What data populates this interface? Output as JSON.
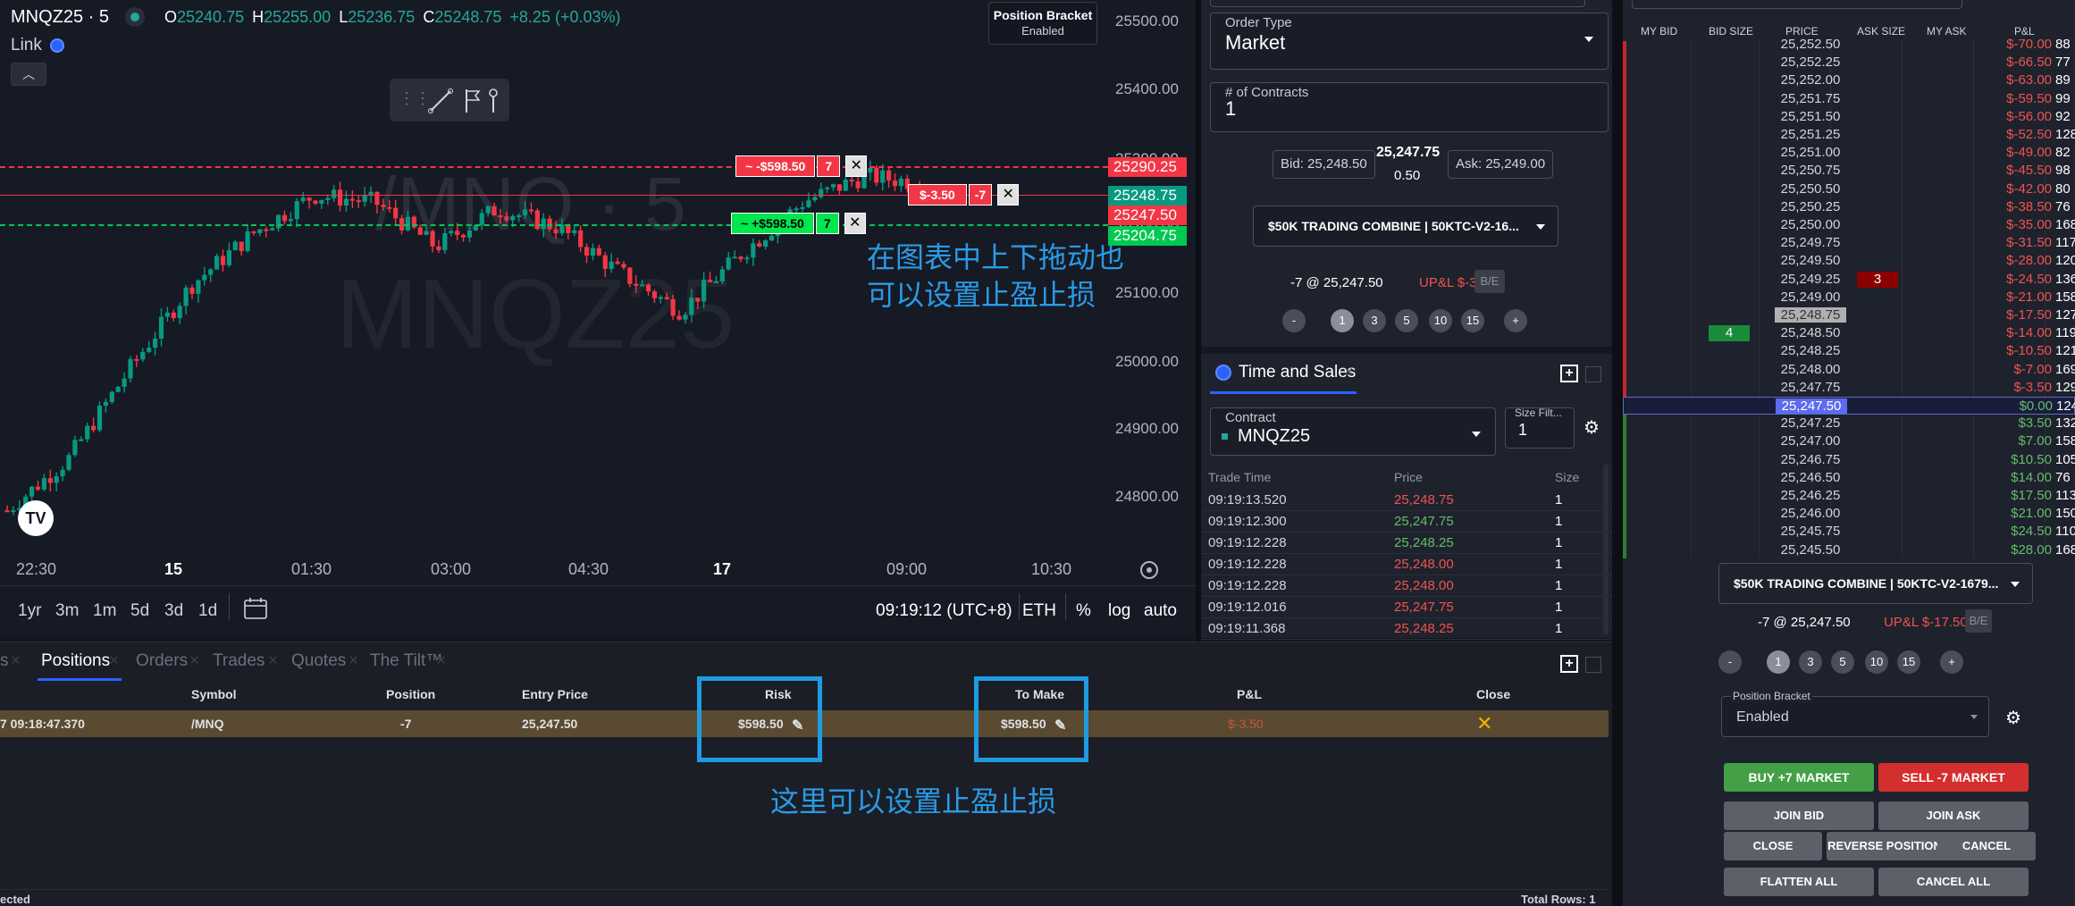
{
  "chart": {
    "symbol": "MNQZ25 · 5",
    "ohlc": {
      "o_label": "O",
      "o": "25240.75",
      "h_label": "H",
      "h": "25255.00",
      "l_label": "L",
      "l": "25236.75",
      "c_label": "C",
      "c": "25248.75",
      "change": "+8.25 (+0.03%)"
    },
    "link_label": "Link",
    "watermark_top": "/MNQ · 5",
    "watermark_bottom": "MNQZ25",
    "position_bracket_title": "Position Bracket",
    "position_bracket_value": "Enabled",
    "price_axis": [
      "25500.00",
      "25400.00",
      "25300.00",
      "25200.00",
      "25100.00",
      "25000.00",
      "24900.00",
      "24800.00"
    ],
    "price_tags": [
      {
        "label": "25290.25",
        "color": "#f23645"
      },
      {
        "label": "25248.75",
        "color": "#089981"
      },
      {
        "label": "25247.50",
        "color": "#f23645"
      },
      {
        "label": "25204.75",
        "color": "#00c853"
      }
    ],
    "order_tags": {
      "stop_text": "~ -$598.50",
      "stop_qty": "7",
      "target_text": "~ +$598.50",
      "target_qty": "7",
      "pos_text": "$-3.50",
      "pos_qty": "-7"
    },
    "time_axis": [
      "22:30",
      "15",
      "01:30",
      "03:00",
      "04:30",
      "17",
      "09:00",
      "10:30"
    ],
    "annotation": "在图表中上下拖动也\n可以设置止盈止损",
    "timeframes": [
      "1yr",
      "3m",
      "1m",
      "5d",
      "3d",
      "1d"
    ],
    "clock": "09:19:12 (UTC+8)",
    "session": "ETH",
    "scale_opts": [
      "%",
      "log",
      "auto"
    ]
  },
  "chart_data": {
    "type": "candlestick",
    "x": [
      "22:30",
      "15",
      "01:30",
      "03:00",
      "04:30",
      "17",
      "09:00"
    ],
    "close_path": [
      24740,
      24820,
      24960,
      25090,
      25170,
      25230,
      25220,
      25150,
      25210,
      25180,
      25110,
      25050,
      25140,
      25220,
      25260,
      25248.75
    ],
    "ylim": [
      24700,
      25520
    ]
  },
  "order_entry": {
    "order_type_label": "Order Type",
    "order_type_value": "Market",
    "contracts_label": "# of Contracts",
    "contracts_value": "1",
    "bid": "Bid: 25,248.50",
    "last": "25,247.75",
    "spread": "0.50",
    "ask": "Ask: 25,249.00",
    "account": "$50K TRADING COMBINE | 50KTC-V2-16...",
    "position": "-7 @ 25,247.50",
    "upl": "UP&L $-3.50",
    "be": "B/E",
    "qty_buttons": [
      "-",
      "1",
      "3",
      "5",
      "10",
      "15",
      "+"
    ]
  },
  "tns": {
    "title": "Time and Sales",
    "contract_label": "Contract",
    "contract_value": "MNQZ25",
    "size_filter_label": "Size Filt...",
    "size_filter_value": "1",
    "headers": [
      "Trade Time",
      "Price",
      "Size"
    ],
    "rows": [
      {
        "time": "09:19:13.520",
        "price": "25,248.75",
        "size": "1",
        "color": "#ef5350"
      },
      {
        "time": "09:19:12.300",
        "price": "25,247.75",
        "size": "1",
        "color": "#66bb6a"
      },
      {
        "time": "09:19:12.228",
        "price": "25,248.25",
        "size": "1",
        "color": "#66bb6a"
      },
      {
        "time": "09:19:12.228",
        "price": "25,248.00",
        "size": "1",
        "color": "#ef5350"
      },
      {
        "time": "09:19:12.228",
        "price": "25,248.00",
        "size": "1",
        "color": "#ef5350"
      },
      {
        "time": "09:19:12.016",
        "price": "25,247.75",
        "size": "1",
        "color": "#ef5350"
      },
      {
        "time": "09:19:11.368",
        "price": "25,248.25",
        "size": "1",
        "color": "#ef5350"
      }
    ]
  },
  "dom": {
    "headers": [
      "MY BID",
      "BID SIZE",
      "PRICE",
      "ASK SIZE",
      "MY ASK",
      "P&L"
    ],
    "rows": [
      {
        "price": "25,252.50",
        "ask": "",
        "bid": "",
        "pnl": "$-70.00",
        "extra": "88",
        "pc": "#ef5350"
      },
      {
        "price": "25,252.25",
        "ask": "",
        "bid": "",
        "pnl": "$-66.50",
        "extra": "77",
        "pc": "#ef5350"
      },
      {
        "price": "25,252.00",
        "ask": "",
        "bid": "",
        "pnl": "$-63.00",
        "extra": "89",
        "pc": "#ef5350"
      },
      {
        "price": "25,251.75",
        "ask": "",
        "bid": "",
        "pnl": "$-59.50",
        "extra": "99",
        "pc": "#ef5350"
      },
      {
        "price": "25,251.50",
        "ask": "",
        "bid": "",
        "pnl": "$-56.00",
        "extra": "92",
        "pc": "#ef5350"
      },
      {
        "price": "25,251.25",
        "ask": "",
        "bid": "",
        "pnl": "$-52.50",
        "extra": "128",
        "pc": "#ef5350"
      },
      {
        "price": "25,251.00",
        "ask": "",
        "bid": "",
        "pnl": "$-49.00",
        "extra": "82",
        "pc": "#ef5350"
      },
      {
        "price": "25,250.75",
        "ask": "",
        "bid": "",
        "pnl": "$-45.50",
        "extra": "98",
        "pc": "#ef5350"
      },
      {
        "price": "25,250.50",
        "ask": "",
        "bid": "",
        "pnl": "$-42.00",
        "extra": "80",
        "pc": "#ef5350"
      },
      {
        "price": "25,250.25",
        "ask": "",
        "bid": "",
        "pnl": "$-38.50",
        "extra": "76",
        "pc": "#ef5350"
      },
      {
        "price": "25,250.00",
        "ask": "",
        "bid": "",
        "pnl": "$-35.00",
        "extra": "168",
        "pc": "#ef5350"
      },
      {
        "price": "25,249.75",
        "ask": "",
        "bid": "",
        "pnl": "$-31.50",
        "extra": "117",
        "pc": "#ef5350"
      },
      {
        "price": "25,249.50",
        "ask": "",
        "bid": "",
        "pnl": "$-28.00",
        "extra": "120",
        "pc": "#ef5350"
      },
      {
        "price": "25,249.25",
        "ask": "3",
        "bid": "",
        "pnl": "$-24.50",
        "extra": "136",
        "pc": "#ef5350"
      },
      {
        "price": "25,249.00",
        "ask": "",
        "bid": "",
        "pnl": "$-21.00",
        "extra": "158",
        "pc": "#ef5350"
      },
      {
        "price": "25,248.75",
        "ask": "",
        "bid": "",
        "pnl": "$-17.50",
        "extra": "127",
        "pc": "#ef5350"
      },
      {
        "price": "25,248.50",
        "ask": "",
        "bid": "4",
        "pnl": "$-14.00",
        "extra": "119",
        "pc": "#ef5350"
      },
      {
        "price": "25,248.25",
        "ask": "",
        "bid": "",
        "pnl": "$-10.50",
        "extra": "121",
        "pc": "#ef5350"
      },
      {
        "price": "25,248.00",
        "ask": "",
        "bid": "",
        "pnl": "$-7.00",
        "extra": "169",
        "pc": "#ef5350"
      },
      {
        "price": "25,247.75",
        "ask": "",
        "bid": "",
        "pnl": "$-3.50",
        "extra": "129",
        "pc": "#ef5350"
      },
      {
        "price": "25,247.50",
        "ask": "",
        "bid": "",
        "pnl": "$0.00",
        "extra": "124",
        "pc": "#66bb6a"
      },
      {
        "price": "25,247.25",
        "ask": "",
        "bid": "",
        "pnl": "$3.50",
        "extra": "132",
        "pc": "#66bb6a"
      },
      {
        "price": "25,247.00",
        "ask": "",
        "bid": "",
        "pnl": "$7.00",
        "extra": "158",
        "pc": "#66bb6a"
      },
      {
        "price": "25,246.75",
        "ask": "",
        "bid": "",
        "pnl": "$10.50",
        "extra": "105",
        "pc": "#66bb6a"
      },
      {
        "price": "25,246.50",
        "ask": "",
        "bid": "",
        "pnl": "$14.00",
        "extra": "76",
        "pc": "#66bb6a"
      },
      {
        "price": "25,246.25",
        "ask": "",
        "bid": "",
        "pnl": "$17.50",
        "extra": "113",
        "pc": "#66bb6a"
      },
      {
        "price": "25,246.00",
        "ask": "",
        "bid": "",
        "pnl": "$21.00",
        "extra": "150",
        "pc": "#66bb6a"
      },
      {
        "price": "25,245.75",
        "ask": "",
        "bid": "",
        "pnl": "$24.50",
        "extra": "110",
        "pc": "#66bb6a"
      },
      {
        "price": "25,245.50",
        "ask": "",
        "bid": "",
        "pnl": "$28.00",
        "extra": "168",
        "pc": "#66bb6a"
      }
    ],
    "account": "$50K TRADING COMBINE | 50KTC-V2-1679...",
    "position": "-7 @ 25,247.50",
    "upl": "UP&L $-17.50",
    "be": "B/E",
    "qty_buttons": [
      "-",
      "1",
      "3",
      "5",
      "10",
      "15",
      "+"
    ],
    "bracket_label": "Position Bracket",
    "bracket_value": "Enabled",
    "buttons": {
      "buy": "BUY +7 MARKET",
      "sell": "SELL -7 MARKET",
      "join_bid": "JOIN BID",
      "join_ask": "JOIN ASK",
      "close": "CLOSE POSITION",
      "reverse": "REVERSE POSITION",
      "cancel_orders": "CANCEL ORDERS",
      "flatten": "FLATTEN ALL",
      "cancel_all": "CANCEL ALL"
    }
  },
  "positions": {
    "tabs": [
      "s",
      "Positions",
      "Orders",
      "Trades",
      "Quotes",
      "The Tilt™"
    ],
    "headers": [
      "Symbol",
      "Position",
      "Entry Price",
      "Risk",
      "To Make",
      "P&L",
      "Close"
    ],
    "row": {
      "time": "7 09:18:47.370",
      "symbol": "/MNQ",
      "position": "-7",
      "entry": "25,247.50",
      "risk": "$598.50",
      "to_make": "$598.50",
      "pnl": "$-3.50"
    },
    "annotation": "这里可以设置止盈止损",
    "status_left": "ected",
    "status_right": "Total Rows: 1"
  }
}
